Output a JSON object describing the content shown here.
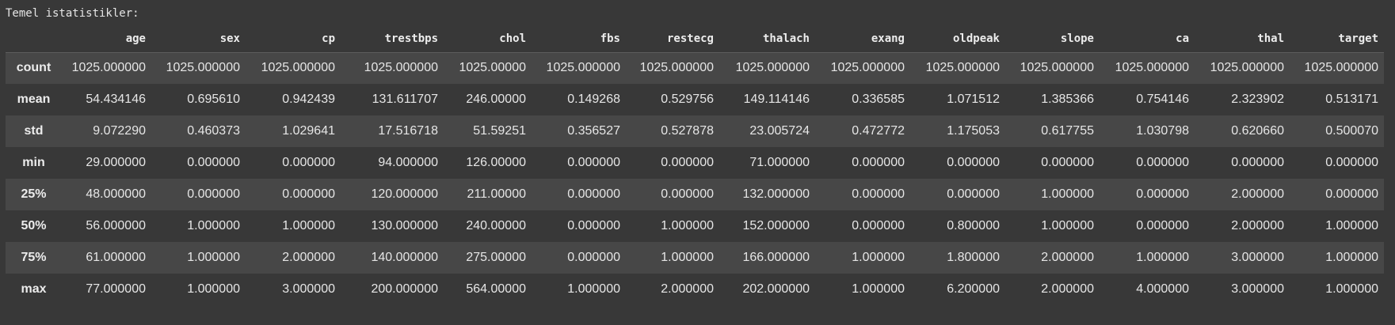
{
  "caption": "Temel istatistikler:",
  "columns": [
    "age",
    "sex",
    "cp",
    "trestbps",
    "chol",
    "fbs",
    "restecg",
    "thalach",
    "exang",
    "oldpeak",
    "slope",
    "ca",
    "thal",
    "target"
  ],
  "rows": [
    {
      "label": "count",
      "values": [
        "1025.000000",
        "1025.000000",
        "1025.000000",
        "1025.000000",
        "1025.00000",
        "1025.000000",
        "1025.000000",
        "1025.000000",
        "1025.000000",
        "1025.000000",
        "1025.000000",
        "1025.000000",
        "1025.000000",
        "1025.000000"
      ]
    },
    {
      "label": "mean",
      "values": [
        "54.434146",
        "0.695610",
        "0.942439",
        "131.611707",
        "246.00000",
        "0.149268",
        "0.529756",
        "149.114146",
        "0.336585",
        "1.071512",
        "1.385366",
        "0.754146",
        "2.323902",
        "0.513171"
      ]
    },
    {
      "label": "std",
      "values": [
        "9.072290",
        "0.460373",
        "1.029641",
        "17.516718",
        "51.59251",
        "0.356527",
        "0.527878",
        "23.005724",
        "0.472772",
        "1.175053",
        "0.617755",
        "1.030798",
        "0.620660",
        "0.500070"
      ]
    },
    {
      "label": "min",
      "values": [
        "29.000000",
        "0.000000",
        "0.000000",
        "94.000000",
        "126.00000",
        "0.000000",
        "0.000000",
        "71.000000",
        "0.000000",
        "0.000000",
        "0.000000",
        "0.000000",
        "0.000000",
        "0.000000"
      ]
    },
    {
      "label": "25%",
      "values": [
        "48.000000",
        "0.000000",
        "0.000000",
        "120.000000",
        "211.00000",
        "0.000000",
        "0.000000",
        "132.000000",
        "0.000000",
        "0.000000",
        "1.000000",
        "0.000000",
        "2.000000",
        "0.000000"
      ]
    },
    {
      "label": "50%",
      "values": [
        "56.000000",
        "1.000000",
        "1.000000",
        "130.000000",
        "240.00000",
        "0.000000",
        "1.000000",
        "152.000000",
        "0.000000",
        "0.800000",
        "1.000000",
        "0.000000",
        "2.000000",
        "1.000000"
      ]
    },
    {
      "label": "75%",
      "values": [
        "61.000000",
        "1.000000",
        "2.000000",
        "140.000000",
        "275.00000",
        "0.000000",
        "1.000000",
        "166.000000",
        "1.000000",
        "1.800000",
        "2.000000",
        "1.000000",
        "3.000000",
        "1.000000"
      ]
    },
    {
      "label": "max",
      "values": [
        "77.000000",
        "1.000000",
        "3.000000",
        "200.000000",
        "564.00000",
        "1.000000",
        "2.000000",
        "202.000000",
        "1.000000",
        "6.200000",
        "2.000000",
        "4.000000",
        "3.000000",
        "1.000000"
      ]
    }
  ],
  "colors": {
    "background": "#383838",
    "row_alt": "#474747",
    "text": "#e6e6e6"
  }
}
